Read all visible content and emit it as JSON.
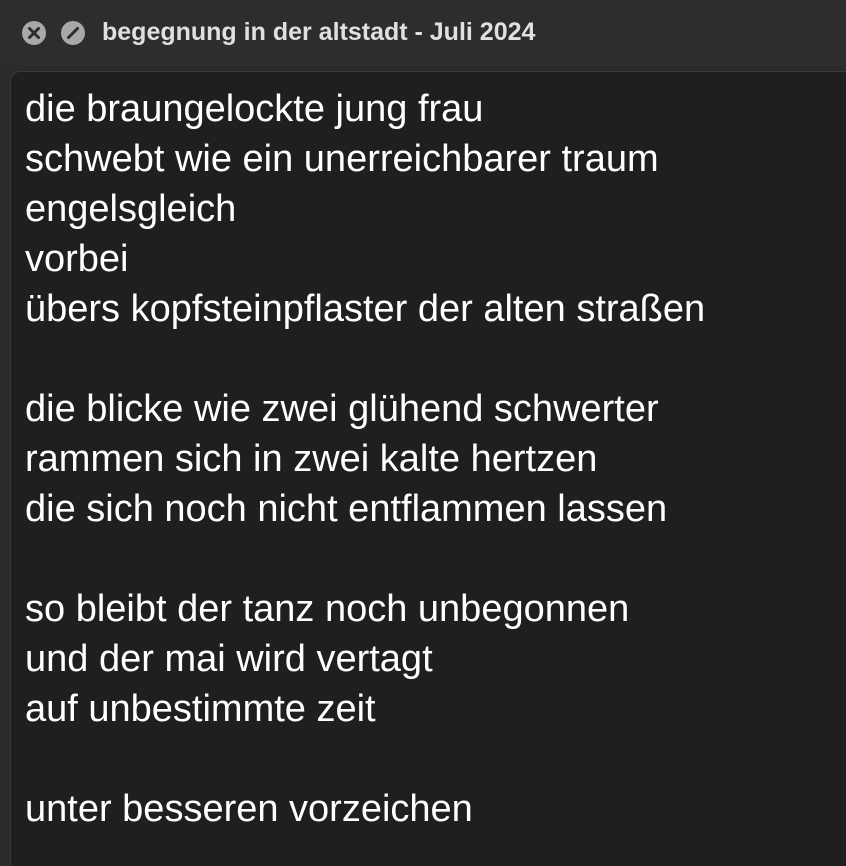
{
  "window": {
    "title": "begegnung in der altstadt - Juli 2024"
  },
  "icons": {
    "close": "close-circle-icon",
    "minimize": "no-entry-circle-icon"
  },
  "poem": {
    "lines": [
      "die braungelockte jung frau",
      "schwebt wie ein unerreichbarer traum",
      "engelsgleich",
      "vorbei",
      "übers kopfsteinpflaster der alten straßen",
      "",
      "die blicke wie zwei glühend schwerter",
      "rammen sich in zwei kalte hertzen",
      "die sich noch nicht entflammen lassen",
      "",
      "so bleibt der tanz noch unbegonnen",
      "und der mai wird vertagt",
      "auf unbestimmte zeit",
      "",
      "unter besseren vorzeichen"
    ]
  },
  "colors": {
    "titlebar_bg": "#2d2d2d",
    "content_bg": "#1f1f1f",
    "text": "#ffffff",
    "title_text": "#e0e0e0",
    "button": "#a8a8a8"
  }
}
